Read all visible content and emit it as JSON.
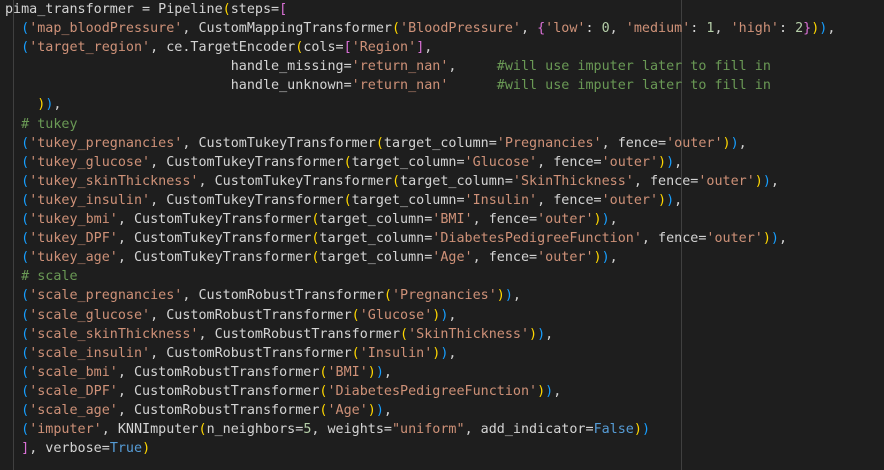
{
  "theme": {
    "background": "#1e1e1e",
    "default_text": "#d4d4d4",
    "string": "#ce9178",
    "comment": "#6a9955",
    "keyword": "#569cd6",
    "number": "#b5cea8",
    "bracket_level_1": "#ffd700",
    "bracket_level_2": "#da70d6",
    "bracket_level_3": "#179fff"
  },
  "code_lines": [
    [
      [
        "pima_transformer = Pipeline",
        "default"
      ],
      [
        "(",
        "bracket1"
      ],
      [
        "steps=",
        "default"
      ],
      [
        "[",
        "bracket2"
      ]
    ],
    [
      [
        "  ",
        "default"
      ],
      [
        "(",
        "bracket3"
      ],
      [
        "'map_bloodPressure'",
        "string"
      ],
      [
        ", CustomMappingTransformer",
        "default"
      ],
      [
        "(",
        "bracket1"
      ],
      [
        "'BloodPressure'",
        "string"
      ],
      [
        ", ",
        "default"
      ],
      [
        "{",
        "bracket2"
      ],
      [
        "'low'",
        "string"
      ],
      [
        ": ",
        "default"
      ],
      [
        "0",
        "number"
      ],
      [
        ", ",
        "default"
      ],
      [
        "'medium'",
        "string"
      ],
      [
        ": ",
        "default"
      ],
      [
        "1",
        "number"
      ],
      [
        ", ",
        "default"
      ],
      [
        "'high'",
        "string"
      ],
      [
        ": ",
        "default"
      ],
      [
        "2",
        "number"
      ],
      [
        "}",
        "bracket2"
      ],
      [
        ")",
        "bracket1"
      ],
      [
        ")",
        "bracket3"
      ],
      [
        ",",
        "default"
      ]
    ],
    [
      [
        "  ",
        "default"
      ],
      [
        "(",
        "bracket3"
      ],
      [
        "'target_region'",
        "string"
      ],
      [
        ", ce.TargetEncoder",
        "default"
      ],
      [
        "(",
        "bracket1"
      ],
      [
        "cols=",
        "default"
      ],
      [
        "[",
        "bracket2"
      ],
      [
        "'Region'",
        "string"
      ],
      [
        "]",
        "bracket2"
      ],
      [
        ",",
        "default"
      ]
    ],
    [
      [
        "                            handle_missing=",
        "default"
      ],
      [
        "'return_nan'",
        "string"
      ],
      [
        ",     ",
        "default"
      ],
      [
        "#will use imputer later to fill in",
        "comment"
      ]
    ],
    [
      [
        "                            handle_unknown=",
        "default"
      ],
      [
        "'return_nan'",
        "string"
      ],
      [
        "      ",
        "default"
      ],
      [
        "#will use imputer later to fill in",
        "comment"
      ]
    ],
    [
      [
        "    ",
        "default"
      ],
      [
        ")",
        "bracket1"
      ],
      [
        ")",
        "bracket3"
      ],
      [
        ",",
        "default"
      ]
    ],
    [
      [
        "  ",
        "default"
      ],
      [
        "# tukey",
        "comment"
      ]
    ],
    [
      [
        "  ",
        "default"
      ],
      [
        "(",
        "bracket3"
      ],
      [
        "'tukey_pregnancies'",
        "string"
      ],
      [
        ", CustomTukeyTransformer",
        "default"
      ],
      [
        "(",
        "bracket1"
      ],
      [
        "target_column=",
        "default"
      ],
      [
        "'Pregnancies'",
        "string"
      ],
      [
        ", fence=",
        "default"
      ],
      [
        "'outer'",
        "string"
      ],
      [
        ")",
        "bracket1"
      ],
      [
        ")",
        "bracket3"
      ],
      [
        ",",
        "default"
      ]
    ],
    [
      [
        "  ",
        "default"
      ],
      [
        "(",
        "bracket3"
      ],
      [
        "'tukey_glucose'",
        "string"
      ],
      [
        ", CustomTukeyTransformer",
        "default"
      ],
      [
        "(",
        "bracket1"
      ],
      [
        "target_column=",
        "default"
      ],
      [
        "'Glucose'",
        "string"
      ],
      [
        ", fence=",
        "default"
      ],
      [
        "'outer'",
        "string"
      ],
      [
        ")",
        "bracket1"
      ],
      [
        ")",
        "bracket3"
      ],
      [
        ",",
        "default"
      ]
    ],
    [
      [
        "  ",
        "default"
      ],
      [
        "(",
        "bracket3"
      ],
      [
        "'tukey_skinThickness'",
        "string"
      ],
      [
        ", CustomTukeyTransformer",
        "default"
      ],
      [
        "(",
        "bracket1"
      ],
      [
        "target_column=",
        "default"
      ],
      [
        "'SkinThickness'",
        "string"
      ],
      [
        ", fence=",
        "default"
      ],
      [
        "'outer'",
        "string"
      ],
      [
        ")",
        "bracket1"
      ],
      [
        ")",
        "bracket3"
      ],
      [
        ",",
        "default"
      ]
    ],
    [
      [
        "  ",
        "default"
      ],
      [
        "(",
        "bracket3"
      ],
      [
        "'tukey_insulin'",
        "string"
      ],
      [
        ", CustomTukeyTransformer",
        "default"
      ],
      [
        "(",
        "bracket1"
      ],
      [
        "target_column=",
        "default"
      ],
      [
        "'Insulin'",
        "string"
      ],
      [
        ", fence=",
        "default"
      ],
      [
        "'outer'",
        "string"
      ],
      [
        ")",
        "bracket1"
      ],
      [
        ")",
        "bracket3"
      ],
      [
        ",",
        "default"
      ]
    ],
    [
      [
        "  ",
        "default"
      ],
      [
        "(",
        "bracket3"
      ],
      [
        "'tukey_bmi'",
        "string"
      ],
      [
        ", CustomTukeyTransformer",
        "default"
      ],
      [
        "(",
        "bracket1"
      ],
      [
        "target_column=",
        "default"
      ],
      [
        "'BMI'",
        "string"
      ],
      [
        ", fence=",
        "default"
      ],
      [
        "'outer'",
        "string"
      ],
      [
        ")",
        "bracket1"
      ],
      [
        ")",
        "bracket3"
      ],
      [
        ",",
        "default"
      ]
    ],
    [
      [
        "  ",
        "default"
      ],
      [
        "(",
        "bracket3"
      ],
      [
        "'tukey_DPF'",
        "string"
      ],
      [
        ", CustomTukeyTransformer",
        "default"
      ],
      [
        "(",
        "bracket1"
      ],
      [
        "target_column=",
        "default"
      ],
      [
        "'DiabetesPedigreeFunction'",
        "string"
      ],
      [
        ", fence=",
        "default"
      ],
      [
        "'outer'",
        "string"
      ],
      [
        ")",
        "bracket1"
      ],
      [
        ")",
        "bracket3"
      ],
      [
        ",",
        "default"
      ]
    ],
    [
      [
        "  ",
        "default"
      ],
      [
        "(",
        "bracket3"
      ],
      [
        "'tukey_age'",
        "string"
      ],
      [
        ", CustomTukeyTransformer",
        "default"
      ],
      [
        "(",
        "bracket1"
      ],
      [
        "target_column=",
        "default"
      ],
      [
        "'Age'",
        "string"
      ],
      [
        ", fence=",
        "default"
      ],
      [
        "'outer'",
        "string"
      ],
      [
        ")",
        "bracket1"
      ],
      [
        ")",
        "bracket3"
      ],
      [
        ",",
        "default"
      ]
    ],
    [
      [
        "  ",
        "default"
      ],
      [
        "# scale",
        "comment"
      ]
    ],
    [
      [
        "  ",
        "default"
      ],
      [
        "(",
        "bracket3"
      ],
      [
        "'scale_pregnancies'",
        "string"
      ],
      [
        ", CustomRobustTransformer",
        "default"
      ],
      [
        "(",
        "bracket1"
      ],
      [
        "'Pregnancies'",
        "string"
      ],
      [
        ")",
        "bracket1"
      ],
      [
        ")",
        "bracket3"
      ],
      [
        ",",
        "default"
      ]
    ],
    [
      [
        "  ",
        "default"
      ],
      [
        "(",
        "bracket3"
      ],
      [
        "'scale_glucose'",
        "string"
      ],
      [
        ", CustomRobustTransformer",
        "default"
      ],
      [
        "(",
        "bracket1"
      ],
      [
        "'Glucose'",
        "string"
      ],
      [
        ")",
        "bracket1"
      ],
      [
        ")",
        "bracket3"
      ],
      [
        ",",
        "default"
      ]
    ],
    [
      [
        "  ",
        "default"
      ],
      [
        "(",
        "bracket3"
      ],
      [
        "'scale_skinThickness'",
        "string"
      ],
      [
        ", CustomRobustTransformer",
        "default"
      ],
      [
        "(",
        "bracket1"
      ],
      [
        "'SkinThickness'",
        "string"
      ],
      [
        ")",
        "bracket1"
      ],
      [
        ")",
        "bracket3"
      ],
      [
        ",",
        "default"
      ]
    ],
    [
      [
        "  ",
        "default"
      ],
      [
        "(",
        "bracket3"
      ],
      [
        "'scale_insulin'",
        "string"
      ],
      [
        ", CustomRobustTransformer",
        "default"
      ],
      [
        "(",
        "bracket1"
      ],
      [
        "'Insulin'",
        "string"
      ],
      [
        ")",
        "bracket1"
      ],
      [
        ")",
        "bracket3"
      ],
      [
        ",",
        "default"
      ]
    ],
    [
      [
        "  ",
        "default"
      ],
      [
        "(",
        "bracket3"
      ],
      [
        "'scale_bmi'",
        "string"
      ],
      [
        ", CustomRobustTransformer",
        "default"
      ],
      [
        "(",
        "bracket1"
      ],
      [
        "'BMI'",
        "string"
      ],
      [
        ")",
        "bracket1"
      ],
      [
        ")",
        "bracket3"
      ],
      [
        ",",
        "default"
      ]
    ],
    [
      [
        "  ",
        "default"
      ],
      [
        "(",
        "bracket3"
      ],
      [
        "'scale_DPF'",
        "string"
      ],
      [
        ", CustomRobustTransformer",
        "default"
      ],
      [
        "(",
        "bracket1"
      ],
      [
        "'DiabetesPedigreeFunction'",
        "string"
      ],
      [
        ")",
        "bracket1"
      ],
      [
        ")",
        "bracket3"
      ],
      [
        ",",
        "default"
      ]
    ],
    [
      [
        "  ",
        "default"
      ],
      [
        "(",
        "bracket3"
      ],
      [
        "'scale_age'",
        "string"
      ],
      [
        ", CustomRobustTransformer",
        "default"
      ],
      [
        "(",
        "bracket1"
      ],
      [
        "'Age'",
        "string"
      ],
      [
        ")",
        "bracket1"
      ],
      [
        ")",
        "bracket3"
      ],
      [
        ",",
        "default"
      ]
    ],
    [
      [
        "  ",
        "default"
      ],
      [
        "(",
        "bracket3"
      ],
      [
        "'imputer'",
        "string"
      ],
      [
        ", KNNImputer",
        "default"
      ],
      [
        "(",
        "bracket1"
      ],
      [
        "n_neighbors=",
        "default"
      ],
      [
        "5",
        "number"
      ],
      [
        ", weights=",
        "default"
      ],
      [
        "\"uniform\"",
        "string"
      ],
      [
        ", add_indicator=",
        "default"
      ],
      [
        "False",
        "keyword"
      ],
      [
        ")",
        "bracket1"
      ],
      [
        ")",
        "bracket3"
      ]
    ],
    [
      [
        "  ",
        "default"
      ],
      [
        "]",
        "bracket2"
      ],
      [
        ", verbose=",
        "default"
      ],
      [
        "True",
        "keyword"
      ],
      [
        ")",
        "bracket1"
      ]
    ]
  ]
}
